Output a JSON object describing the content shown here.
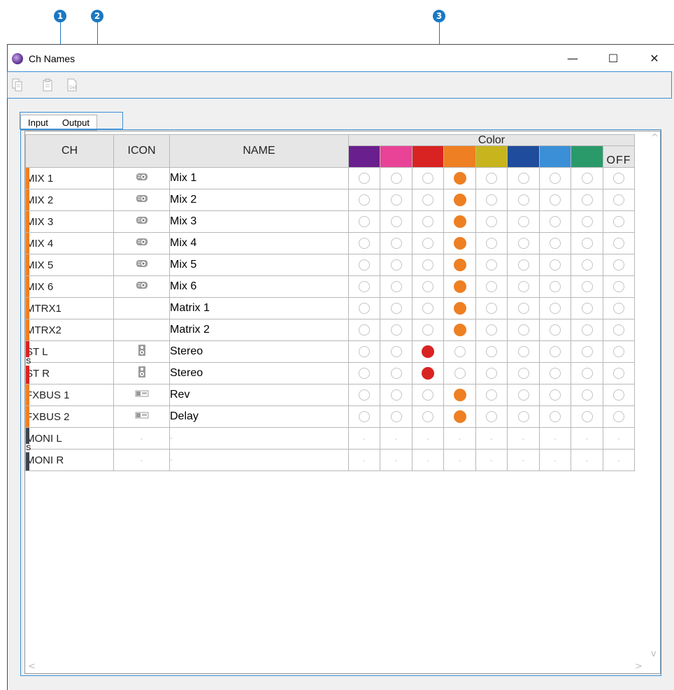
{
  "callouts": [
    "1",
    "2",
    "3"
  ],
  "window": {
    "title": "Ch Names",
    "minimize": "—",
    "maximize": "☐",
    "close": "✕"
  },
  "toolbar": {
    "icons": [
      "copy-icon",
      "paste-icon",
      "default-icon"
    ]
  },
  "tabs": [
    {
      "label": "Input",
      "active": true
    },
    {
      "label": "Output",
      "active": false
    }
  ],
  "table": {
    "headers": {
      "ch": "CH",
      "icon": "ICON",
      "name": "NAME",
      "color": "Color",
      "off": "OFF"
    },
    "swatches": [
      "#6a1f8e",
      "#e84396",
      "#d92323",
      "#ee7f22",
      "#c8b41d",
      "#1f4c9c",
      "#3a8fd6",
      "#2a9a6a"
    ],
    "rows": [
      {
        "ch": "MIX 1",
        "icon": "mix-icon",
        "name": "Mix 1",
        "bar": "#ee7f22",
        "selected": 3
      },
      {
        "ch": "MIX 2",
        "icon": "mix-icon",
        "name": "Mix 2",
        "bar": "#ee7f22",
        "selected": 3
      },
      {
        "ch": "MIX 3",
        "icon": "mix-icon",
        "name": "Mix 3",
        "bar": "#ee7f22",
        "selected": 3
      },
      {
        "ch": "MIX 4",
        "icon": "mix-icon",
        "name": "Mix 4",
        "bar": "#ee7f22",
        "selected": 3
      },
      {
        "ch": "MIX 5",
        "icon": "mix-icon",
        "name": "Mix 5",
        "bar": "#ee7f22",
        "selected": 3
      },
      {
        "ch": "MIX 6",
        "icon": "mix-icon",
        "name": "Mix 6",
        "bar": "#ee7f22",
        "selected": 3
      },
      {
        "ch": "MTRX1",
        "icon": "",
        "name": "Matrix 1",
        "bar": "#ee7f22",
        "selected": 3
      },
      {
        "ch": "MTRX2",
        "icon": "",
        "name": "Matrix 2",
        "bar": "#ee7f22",
        "selected": 3
      },
      {
        "ch": "ST L",
        "icon": "speaker-icon",
        "name": "Stereo",
        "bar": "#d92323",
        "selected": 2
      },
      {
        "ch": "ST R",
        "icon": "speaker-icon",
        "name": "Stereo",
        "bar": "#d92323",
        "selected": 2
      },
      {
        "ch": "FXBUS 1",
        "icon": "fx-icon",
        "name": "Rev",
        "bar": "#ee7f22",
        "selected": 3
      },
      {
        "ch": "FXBUS 2",
        "icon": "fx-icon",
        "name": "Delay",
        "bar": "#ee7f22",
        "selected": 3
      },
      {
        "ch": "MONI L",
        "icon": "-",
        "name": "-",
        "bar": "#3c4452",
        "selected": -1,
        "disabled": true
      },
      {
        "ch": "MONI R",
        "icon": "-",
        "name": "-",
        "bar": "#3c4452",
        "selected": -1,
        "disabled": true
      }
    ]
  },
  "stereo_marker": "S",
  "scroll": {
    "up": "^",
    "down": "v",
    "left": "<",
    "right": ">"
  }
}
